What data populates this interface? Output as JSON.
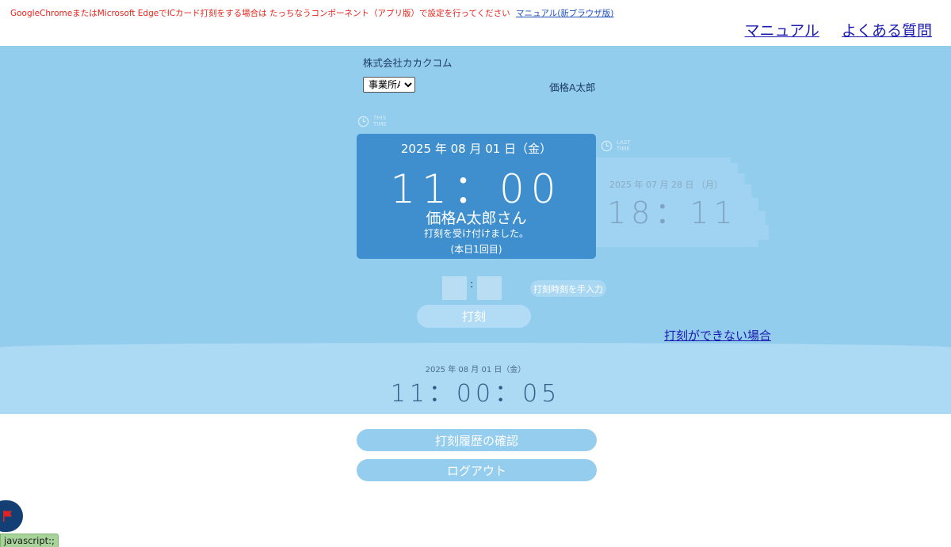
{
  "notice": {
    "text": "GoogleChromeまたはMicrosoft EdgeでICカード打刻をする場合は たっちなうコンポーネント（アプリ版）で設定を行ってください",
    "link": "マニュアル(新ブラウザ版)"
  },
  "header": {
    "manual_link": "マニュアル",
    "faq_link": "よくある質問"
  },
  "company": "株式会社カカクコム",
  "office_select": {
    "selected": "事業所A",
    "options": [
      "事業所A"
    ]
  },
  "user_name": "価格A太郎",
  "this_time": {
    "label": [
      "THIS",
      "TIME"
    ],
    "date": "2025 年 08 月 01 日（金）",
    "clock": "11：00",
    "name": "価格A太郎さん",
    "message": "打刻を受け付けました。",
    "count": "(本日1回目)"
  },
  "last_time": {
    "label": [
      "LAST",
      "TIME"
    ],
    "date": "2025 年 07 月 28 日 （月）",
    "clock": "18：11"
  },
  "manual_entry": {
    "separator": ":",
    "button": "打刻時刻を手入力"
  },
  "stamp_button": "打刻",
  "cannot_stamp_link": "打刻ができない場合",
  "now": {
    "date": "2025 年 08 月 01 日（金）",
    "clock": "11：00：05"
  },
  "history_button": "打刻履歴の確認",
  "logout_button": "ログアウト",
  "status_bar": "javascript:;",
  "colors": {
    "main_band": "#93cdee",
    "current_card": "#3f8fcf",
    "notice_red": "#e8231b",
    "link_blue": "#1a1ab0",
    "flag_red": "#e02424"
  },
  "icons": [
    "clock-icon",
    "flag-icon",
    "chevron-down-icon"
  ]
}
